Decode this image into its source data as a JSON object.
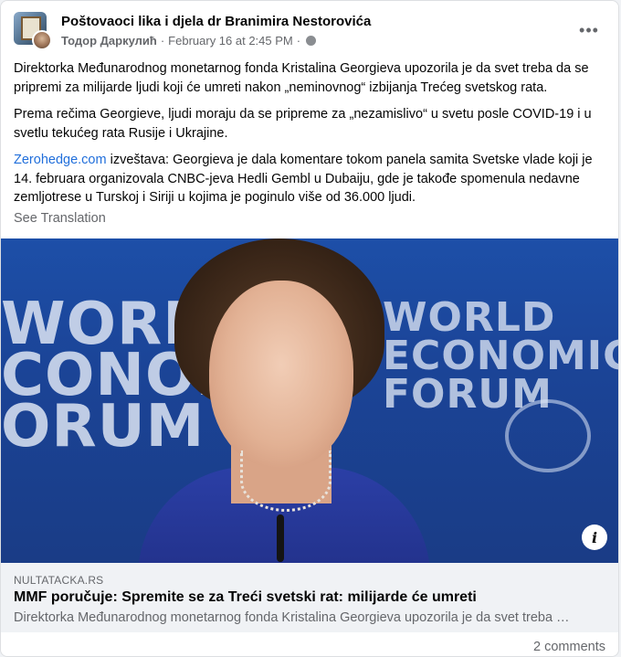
{
  "post": {
    "group_name": "Poštovaoci lika i djela dr Branimira Nestorovića",
    "author": "Тодор Даркулић",
    "timestamp": "February 16 at 2:45 PM",
    "separator": "·",
    "more_label": "•••",
    "paragraphs": {
      "p1": "Direktorka Međunarodnog monetarnog fonda Kristalina Georgieva upozorila je da svet treba da se pripremi za milijarde ljudi koji će umreti nakon „neminovnog“ izbijanja Trećeg svetskog rata.",
      "p2": "Prema rečima Georgieve, ljudi moraju da se pripreme za „nezamislivo“ u svetu posle COVID-19 i u svetlu tekućeg rata Rusije i Ukrajine.",
      "p3_link": "Zerohedge.com",
      "p3_rest": " izveštava: Georgieva je dala komentare tokom panela samita Svetske vlade koji je 14. februara organizovala CNBC-jeva Hedli Gembl u Dubaiju, gde je takođe spomenula nedavne zemljotrese u Turskoj i Siriji u kojima je poginulo više od 36.000 ljudi."
    },
    "see_translation": "See Translation"
  },
  "hero_image": {
    "wef_left": "WORLD\nCONOMIC\nORUM",
    "wef_right": "WORLD\nECONOMIC\nFORUM",
    "info_glyph": "i"
  },
  "link_preview": {
    "domain": "NULTATACKA.RS",
    "title": "MMF poručuje: Spremite se za Treći svetski rat: milijarde će umreti",
    "description": "Direktorka Međunarodnog monetarnog fonda Kristalina Georgieva upozorila je da svet treba …"
  },
  "footer": {
    "comments": "2 comments"
  },
  "colors": {
    "link": "#216fdb",
    "secondary_text": "#65676b",
    "card_bg": "#ffffff",
    "preview_bg": "#f0f2f5",
    "hero_blue": "#1d4fa8"
  }
}
